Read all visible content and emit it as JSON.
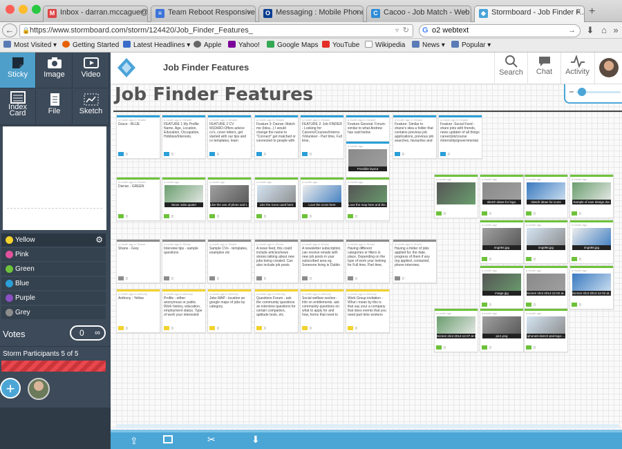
{
  "browser": {
    "tabs": [
      {
        "label": "Inbox - darran.mccague@...",
        "icon": "gmail-icon",
        "color": "#d44"
      },
      {
        "label": "Team Reboot Responsive ...",
        "icon": "docs-icon",
        "color": "#3b74d9"
      },
      {
        "label": "Messaging : Mobile Phone...",
        "icon": "o2-icon",
        "color": "#0a3d91"
      },
      {
        "label": "Cacoo - Job Match - Web",
        "icon": "cacoo-icon",
        "color": "#2f8cd6"
      },
      {
        "label": "Stormboard - Job Finder F...",
        "icon": "stormboard-icon",
        "color": "#4aa3d9"
      }
    ],
    "url": "https://www.stormboard.com/storm/124420/Job_Finder_Features_",
    "search_value": "o2 webtext",
    "bookmarks": [
      "Most Visited ▾",
      "Getting Started",
      "Latest Headlines ▾",
      "Apple",
      "Yahoo!",
      "Google Maps",
      "YouTube",
      "Wikipedia",
      "News ▾",
      "Popular ▾"
    ]
  },
  "tools": [
    {
      "label": "Sticky",
      "icon": "sticky-icon"
    },
    {
      "label": "Image",
      "icon": "camera-icon"
    },
    {
      "label": "Video",
      "icon": "video-icon"
    },
    {
      "label": "Index Card",
      "icon": "index-card-icon"
    },
    {
      "label": "File",
      "icon": "file-icon"
    },
    {
      "label": "Sketch",
      "icon": "sketch-icon"
    }
  ],
  "colors": [
    {
      "label": "Yellow",
      "hex": "#f2d22e"
    },
    {
      "label": "Pink",
      "hex": "#e0529c"
    },
    {
      "label": "Green",
      "hex": "#6dc23a"
    },
    {
      "label": "Blue",
      "hex": "#2a9fd8"
    },
    {
      "label": "Purple",
      "hex": "#8a4fc1"
    },
    {
      "label": "Grey",
      "hex": "#8d8d8d"
    }
  ],
  "votes": {
    "label": "Votes",
    "count": "0"
  },
  "participants": {
    "label": "Storm Participants 5 of 5"
  },
  "header": {
    "title": "Job Finder Features",
    "search": "Search",
    "chat": "Chat",
    "activity": "Activity"
  },
  "board_title": "Job Finder Features",
  "notes": [
    {
      "meta": "a month ago in Header",
      "body": "Grace - BLUE",
      "strip": "#2a9fd8",
      "comments": "0"
    },
    {
      "meta": "a month ago in Header",
      "body": "FEATURE 1 My Profile Name, Age, Location, Education, Occupation, Hobbies/Interests,",
      "strip": "#2a9fd8",
      "comments": "0"
    },
    {
      "meta": "a month ago in Header",
      "body": "FEATURE 2 CV WIZARD-Offers advice cv's, cover letters, get started with our tips and cv templates, learn",
      "strip": "#2a9fd8",
      "comments": "0"
    },
    {
      "meta": "a month ago in Header",
      "body": "Feature 3: Darran: Match me (Idea...) I would change the name to \"Connect\" get matched or connected to people with",
      "strip": "#2a9fd8",
      "comments": "0"
    },
    {
      "meta": "a month ago in Header",
      "body": "FEATURE 2: Job FINDER - Looking for: Careers/Courses/Interns /Volunteer - Part time, Full time,",
      "strip": "#2a9fd8",
      "comments": "0"
    },
    {
      "meta": "a month ago in Header",
      "body": "Feature General: Forum-similar to what Andrew has said below",
      "strip": "#2a9fd8",
      "comments": "0"
    },
    {
      "meta": "a month ago in Header",
      "body": "Feature- Similar to shane's idea a folder that contains previous job applications, previous job searches, favourites and",
      "strip": "#2a9fd8",
      "comments": "0"
    },
    {
      "meta": "a month ago in Header",
      "body": "Feature -Social Feed - share jobs with friends, news updater of all things career/job/course /internship/governmental",
      "strip": "#2a9fd8",
      "comments": "0"
    },
    {
      "meta": "a month ago",
      "caption": "Possible layout",
      "strip": "#2a9fd8",
      "comments": "0"
    },
    {
      "meta": "a month ago in Darran",
      "body": "Darran - GREEN",
      "strip": "#6dc23a",
      "comments": "0"
    },
    {
      "meta": "a month ago",
      "caption": "Stove Jobs quote!",
      "strip": "#6dc23a",
      "comments": "0"
    },
    {
      "meta": "a month ago",
      "caption": "Like the use of photo and t...",
      "strip": "#6dc23a",
      "comments": "0"
    },
    {
      "meta": "a month ago",
      "caption": "Like the icons used here",
      "strip": "#6dc23a",
      "comments": "0"
    },
    {
      "meta": "a month ago",
      "caption": "Love the icons here",
      "strip": "#6dc23a",
      "comments": "0"
    },
    {
      "meta": "a month ago",
      "caption": "Love the map here and the...",
      "strip": "#6dc23a",
      "comments": "0"
    },
    {
      "meta": "a month ago in Shane",
      "body": "Shane - Grey",
      "strip": "#8d8d8d",
      "comments": "0"
    },
    {
      "meta": "a month ago in Shane",
      "body": "Interview tips - sample questions",
      "strip": "#8d8d8d",
      "comments": "0"
    },
    {
      "meta": "a month ago in Shane",
      "body": "Sample CVs - templates, examples etc",
      "strip": "#8d8d8d",
      "comments": "0"
    },
    {
      "meta": "a month ago in Shane",
      "body": "A news feed, this could include articles/news stories talking about new jobs being created. Can also include job posts",
      "strip": "#8d8d8d",
      "comments": "0"
    },
    {
      "meta": "a month ago in Shane",
      "body": "A newsletter subscription, can receive emails with new job posts in your subscribed area eg. Someone living in Dublin",
      "strip": "#8d8d8d",
      "comments": "0"
    },
    {
      "meta": "a month ago in Shane",
      "body": "Having different categories or filters in place. Depending on the type of work your looking for Full time, Part time,",
      "strip": "#8d8d8d",
      "comments": "0"
    },
    {
      "meta": "a month ago in Shane",
      "body": "Having a folder of jobs applied for, the date, progress of them if any (eg applied, contacted, phone interview,",
      "strip": "#8d8d8d",
      "comments": "0"
    },
    {
      "meta": "a month ago in Anthony",
      "body": "Anthony - Yellow",
      "strip": "#f2d22e",
      "comments": "0"
    },
    {
      "meta": "a month ago in Anthony",
      "body": "Profile - either anonymous or public. Work history, education, employment status. Type of work your interested",
      "strip": "#f2d22e",
      "comments": "0"
    },
    {
      "meta": "a month ago in Anthony",
      "body": "Jobs MAP - location an google maps of jobs by category.",
      "strip": "#f2d22e",
      "comments": "0"
    },
    {
      "meta": "a month ago in Anthony",
      "body": "Questions Forum - ask the community questions an interview questions for certain companies, aptitude tests, etc.",
      "strip": "#f2d22e",
      "comments": "0"
    },
    {
      "meta": "a month ago in Anthony",
      "body": "Social welfare section - info on entitlements. ask community questions on what to apply for and how, forms that need to",
      "strip": "#f2d22e",
      "comments": "0"
    },
    {
      "meta": "a month ago in Anthony",
      "body": "Work Group invitation - Whut i mean by this is that say your a company that does events that you need part time workers",
      "strip": "#f2d22e",
      "comments": "0"
    },
    {
      "meta": "a month ago",
      "caption": "",
      "strip": "#6dc23a",
      "comments": "0"
    },
    {
      "meta": "a month ago",
      "caption": "sketch ideas for logo.",
      "strip": "#6dc23a",
      "comments": "0"
    },
    {
      "meta": "a month ago",
      "caption": "sketch ideas for icons",
      "strip": "#6dc23a",
      "comments": "0"
    },
    {
      "meta": "a month ago",
      "caption": "Sample of user design doc",
      "strip": "#6dc23a",
      "comments": "0"
    },
    {
      "meta": "a month ago",
      "caption": "img094.jpg",
      "strip": "#6dc23a",
      "comments": "0"
    },
    {
      "meta": "a month ago",
      "caption": "img096.jpg",
      "strip": "#6dc23a",
      "comments": "0"
    },
    {
      "meta": "a month ago",
      "caption": "img098.jpg",
      "strip": "#6dc23a",
      "comments": "0"
    },
    {
      "meta": "a month ago",
      "caption": "image.jpg",
      "strip": "#6dc23a",
      "comments": "0"
    },
    {
      "meta": "a month ago",
      "caption": "Screen shot 2014-12-02 at...",
      "strip": "#6dc23a",
      "comments": "0"
    },
    {
      "meta": "a month ago",
      "caption": "Screen shot 2014-12-02 at...",
      "strip": "#6dc23a",
      "comments": "0"
    },
    {
      "meta": "a month ago",
      "caption": "Screen shot 2014-12-07 at 1...",
      "strip": "#6dc23a",
      "comments": "0"
    },
    {
      "meta": "a month ago",
      "caption": "pic1.png",
      "strip": "#6dc23a",
      "comments": "0"
    },
    {
      "meta": "a month ago",
      "caption": "iphone6-sketch-psd-logo-...",
      "strip": "#6dc23a",
      "comments": "0"
    }
  ]
}
